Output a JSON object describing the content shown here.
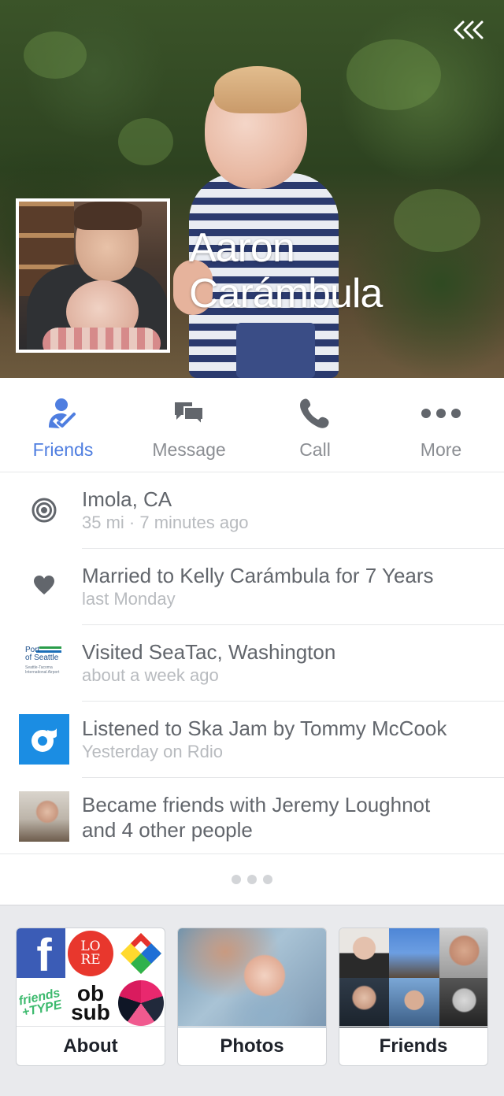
{
  "profile": {
    "first_name": "Aaron",
    "last_name": "Carámbula"
  },
  "actions": [
    {
      "label": "Friends",
      "icon": "friends-check-icon",
      "active": true
    },
    {
      "label": "Message",
      "icon": "message-bubbles-icon",
      "active": false
    },
    {
      "label": "Call",
      "icon": "phone-icon",
      "active": false
    },
    {
      "label": "More",
      "icon": "more-dots-icon",
      "active": false
    }
  ],
  "activity": [
    {
      "primary": "Imola, CA",
      "secondary": "35 mi · 7 minutes ago",
      "icon": "location-target-icon"
    },
    {
      "primary": "Married to Kelly Carámbula for 7 Years",
      "secondary": "last Monday",
      "icon": "heart-icon"
    },
    {
      "primary": "Visited SeaTac, Washington",
      "secondary": "about a week ago",
      "icon": "port-of-seattle-logo",
      "logo_text": {
        "line1": "Port",
        "line2": "of Seattle",
        "line3": "Seattle-Tacoma",
        "line4": "International Airport"
      }
    },
    {
      "primary": "Listened to Ska Jam by Tommy McCook",
      "secondary": "Yesterday on Rdio",
      "icon": "rdio-icon"
    },
    {
      "primary_line1": "Became friends with Jeremy Loughnot",
      "primary_line2": "and 4 other people",
      "icon": "friend-avatar"
    }
  ],
  "cards": {
    "about": {
      "title": "About",
      "tiles": {
        "fb": "f",
        "lore_1": "LO",
        "lore_2": "RE",
        "ft_1": "friends",
        "ft_2": "+TYPE",
        "obsub_1": "ob",
        "obsub_2": "sub"
      }
    },
    "photos": {
      "title": "Photos"
    },
    "friends": {
      "title": "Friends"
    }
  },
  "colors": {
    "accent": "#4f7ee0",
    "icon_gray": "#62666c",
    "text_secondary": "#b8bbbf",
    "facebook_blue": "#3b5cb6",
    "rdio_blue": "#1b8de3"
  }
}
